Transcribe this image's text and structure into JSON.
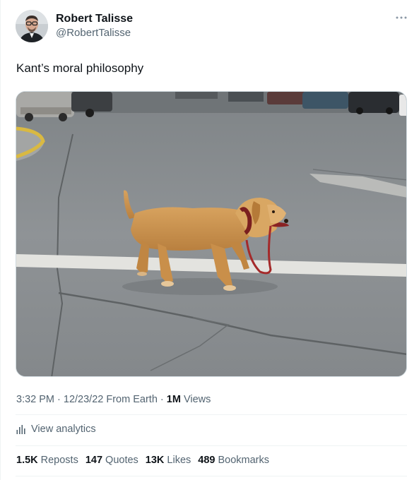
{
  "author": {
    "name": "Robert Talisse",
    "handle": "@RobertTalisse",
    "avatar_icon": "person-avatar"
  },
  "more_icon": "ellipsis-icon",
  "tweet": {
    "text": "Kant’s moral philosophy"
  },
  "media": {
    "alt": "Golden retriever walking across a parking lot holding its own red leash in its mouth"
  },
  "meta": {
    "time": "3:32 PM",
    "date": "12/23/22",
    "source": "From Earth",
    "views_count": "1M",
    "views_label": "Views"
  },
  "analytics": {
    "icon": "bar-chart-icon",
    "label": "View analytics"
  },
  "stats": [
    {
      "count": "1.5K",
      "label": "Reposts"
    },
    {
      "count": "147",
      "label": "Quotes"
    },
    {
      "count": "13K",
      "label": "Likes"
    },
    {
      "count": "489",
      "label": "Bookmarks"
    }
  ],
  "colors": {
    "text": "#0f1419",
    "secondary": "#536471",
    "divider": "#eff3f4"
  }
}
